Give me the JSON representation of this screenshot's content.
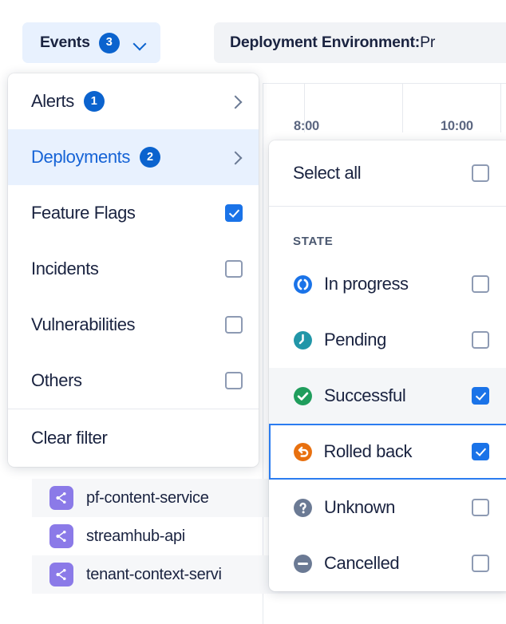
{
  "toolbar": {
    "events_button": {
      "label": "Events",
      "count": "3",
      "chevron": "chevron-down-icon"
    },
    "environment_button": {
      "key": "Deployment Environment:",
      "value": " Pr"
    }
  },
  "chart_axis": {
    "ticks": [
      "8:00",
      "10:00"
    ]
  },
  "services": [
    {
      "name": "pf-content-service",
      "icon": "service-node-icon"
    },
    {
      "name": "streamhub-api",
      "icon": "service-node-icon"
    },
    {
      "name": "tenant-context-servi",
      "icon": "service-node-icon"
    }
  ],
  "events_menu": {
    "items": [
      {
        "label": "Alerts",
        "badge": "1",
        "trailing": "chevron",
        "selected": false,
        "checked": false
      },
      {
        "label": "Deployments",
        "badge": "2",
        "trailing": "chevron",
        "selected": true,
        "checked": false
      },
      {
        "label": "Feature Flags",
        "badge": "",
        "trailing": "checkbox",
        "selected": false,
        "checked": true
      },
      {
        "label": "Incidents",
        "badge": "",
        "trailing": "checkbox",
        "selected": false,
        "checked": false
      },
      {
        "label": "Vulnerabilities",
        "badge": "",
        "trailing": "checkbox",
        "selected": false,
        "checked": false
      },
      {
        "label": "Others",
        "badge": "",
        "trailing": "checkbox",
        "selected": false,
        "checked": false
      }
    ],
    "clear_filter": "Clear filter"
  },
  "state_submenu": {
    "select_all": {
      "label": "Select all",
      "checked": false
    },
    "group_header": "STATE",
    "items": [
      {
        "label": "In progress",
        "icon": "in-progress-icon",
        "color": "#1a73e8",
        "checked": false,
        "hover": false,
        "focused": false
      },
      {
        "label": "Pending",
        "icon": "pending-clock-icon",
        "color": "#2196a8",
        "checked": false,
        "hover": false,
        "focused": false
      },
      {
        "label": "Successful",
        "icon": "success-check-icon",
        "color": "#1f9d5c",
        "checked": true,
        "hover": true,
        "focused": false
      },
      {
        "label": "Rolled back",
        "icon": "rolled-back-icon",
        "color": "#e8700f",
        "checked": true,
        "hover": false,
        "focused": true
      },
      {
        "label": "Unknown",
        "icon": "unknown-question-icon",
        "color": "#6b7a94",
        "checked": false,
        "hover": false,
        "focused": false
      },
      {
        "label": "Cancelled",
        "icon": "cancelled-minus-icon",
        "color": "#6b7a94",
        "checked": false,
        "hover": false,
        "focused": false
      }
    ]
  },
  "colors": {
    "accent_blue": "#1a73e8",
    "badge_blue": "#0b63ce",
    "selected_row_bg": "#e8f1fe",
    "focus_border": "#2b7cf0",
    "service_icon_purple": "#8b7ae8"
  }
}
